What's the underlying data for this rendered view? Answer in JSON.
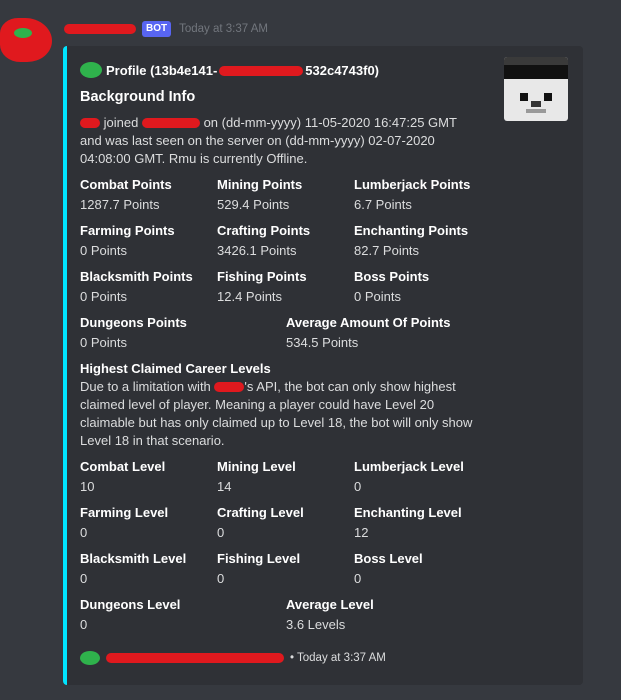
{
  "message": {
    "username": "",
    "bot_badge": "BOT",
    "timestamp": "Today at 3:37 AM"
  },
  "embed": {
    "accent_color": "#00e5ff",
    "author": "Profile (13b4e141-",
    "author_suffix": "532c4743f0)",
    "title": "Background Info",
    "description_part1": "joined",
    "description_part2": "on (dd-mm-yyyy) 11-05-2020 16:47:25 GMT and was last seen on the server on (dd-mm-yyyy) 02-07-2020 04:08:00 GMT. Rmu is currently Offline.",
    "points_fields": [
      {
        "name": "Combat Points",
        "value": "1287.7 Points"
      },
      {
        "name": "Mining Points",
        "value": "529.4 Points"
      },
      {
        "name": "Lumberjack Points",
        "value": "6.7 Points"
      },
      {
        "name": "Farming Points",
        "value": "0 Points"
      },
      {
        "name": "Crafting Points",
        "value": "3426.1 Points"
      },
      {
        "name": "Enchanting Points",
        "value": "82.7 Points"
      },
      {
        "name": "Blacksmith Points",
        "value": "0 Points"
      },
      {
        "name": "Fishing Points",
        "value": "12.4 Points"
      },
      {
        "name": "Boss Points",
        "value": "0 Points"
      },
      {
        "name": "Dungeons Points",
        "value": "0 Points"
      },
      {
        "name": "Average Amount Of Points",
        "value": "534.5 Points"
      }
    ],
    "career_title": "Highest Claimed Career Levels",
    "career_text_part1": "Due to a limitation with",
    "career_text_part2": "'s API, the bot can only show highest claimed level of player. Meaning a player could have Level 20 claimable but has only claimed up to Level 18, the bot will only show Level 18 in that scenario.",
    "level_fields": [
      {
        "name": "Combat Level",
        "value": "10"
      },
      {
        "name": "Mining Level",
        "value": "14"
      },
      {
        "name": "Lumberjack Level",
        "value": "0"
      },
      {
        "name": "Farming Level",
        "value": "0"
      },
      {
        "name": "Crafting Level",
        "value": "0"
      },
      {
        "name": "Enchanting Level",
        "value": "12"
      },
      {
        "name": "Blacksmith Level",
        "value": "0"
      },
      {
        "name": "Fishing Level",
        "value": "0"
      },
      {
        "name": "Boss Level",
        "value": "0"
      },
      {
        "name": "Dungeons Level",
        "value": "0"
      },
      {
        "name": "Average Level",
        "value": "3.6 Levels"
      }
    ],
    "footer_time": "• Today at 3:37 AM"
  }
}
